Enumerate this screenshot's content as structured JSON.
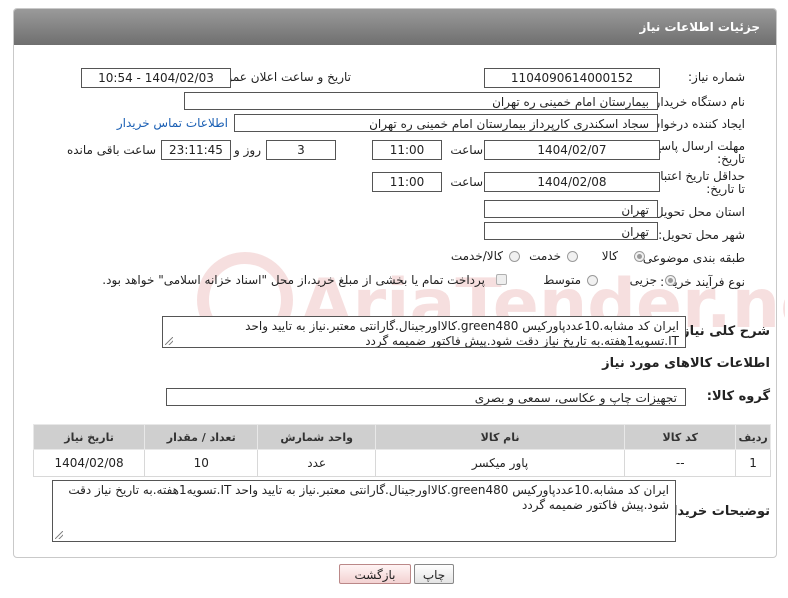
{
  "header": {
    "title": "جزئیات اطلاعات نیاز"
  },
  "form": {
    "need_number": {
      "label": "شماره نیاز:",
      "value": "1104090614000152"
    },
    "announce": {
      "label": "تاریخ و ساعت اعلان عمومی:",
      "value": "1404/02/03 - 10:54"
    },
    "buyer_org": {
      "label": "نام دستگاه خریدار:",
      "value": "بیمارستان امام خمینی ره  تهران"
    },
    "creator": {
      "label": "ایجاد کننده درخواست:",
      "value": "سجاد اسکندری کارپرداز بیمارستان امام خمینی ره  تهران",
      "contact_link": "اطلاعات تماس خریدار"
    },
    "reply_deadline": {
      "label_line1": "مهلت ارسال پاسخ: تا",
      "label_line2": "تاریخ:",
      "date": "1404/02/07",
      "time_label": "ساعت",
      "time": "11:00",
      "days": "3",
      "days_label": "روز و",
      "remaining": "23:11:45",
      "remaining_label": "ساعت باقی مانده"
    },
    "price_validity": {
      "label_line1": "حداقل تاریخ اعتبار قیمت:",
      "label_line2": "تا تاریخ:",
      "date": "1404/02/08",
      "time_label": "ساعت",
      "time": "11:00"
    },
    "province": {
      "label": "استان محل تحویل:",
      "value": "تهران"
    },
    "city": {
      "label": "شهر محل تحویل:",
      "value": "تهران"
    },
    "category": {
      "label": "طبقه بندی موضوعی:",
      "options": [
        "کالا",
        "خدمت",
        "کالا/خدمت"
      ],
      "selected": "کالا"
    },
    "purchase_type": {
      "label": "نوع فرآیند خرید :",
      "options": [
        "جزیی",
        "متوسط"
      ],
      "selected": "جزیی",
      "treasury_note": "پرداخت تمام یا بخشی از مبلغ خرید،از محل \"اسناد خزانه اسلامی\" خواهد بود."
    },
    "description": {
      "label": "شرح کلی نیاز:",
      "value": "ایران کد مشابه.10عددپاورکیس green480.کالااورجینال.گارانتی معتبر.نیاز به تایید واحد IT.تسویه1هفته.به تاریخ نیاز دقت شود.پیش فاکتور ضمیمه گردد"
    }
  },
  "goods": {
    "section_title": "اطلاعات کالاهای مورد نیاز",
    "group_label": "گروه کالا:",
    "group_value": "تجهیزات چاپ و عکاسی، سمعی و بصری",
    "columns": [
      "ردیف",
      "کد کالا",
      "نام کالا",
      "واحد شمارش",
      "تعداد / مقدار",
      "تاریخ نیاز"
    ],
    "rows": [
      {
        "row": "1",
        "code": "--",
        "name": "پاور میکسر",
        "unit": "عدد",
        "qty": "10",
        "date": "1404/02/08"
      }
    ]
  },
  "buyer_notes": {
    "label": "توضیحات خریدار:",
    "value": "ایران کد مشابه.10عددپاورکیس green480.کالااورجینال.گارانتی معتبر.نیاز به تایید واحد IT.تسویه1هفته.به تاریخ نیاز دقت شود.پیش فاکتور ضمیمه گردد"
  },
  "buttons": {
    "print": "چاپ",
    "back": "بازگشت"
  },
  "watermark": {
    "text": "AriaTender.neT"
  },
  "colors": {
    "header": "#7f7f7f",
    "link": "#1a5fb4",
    "back_button": "#f3d2d2"
  }
}
